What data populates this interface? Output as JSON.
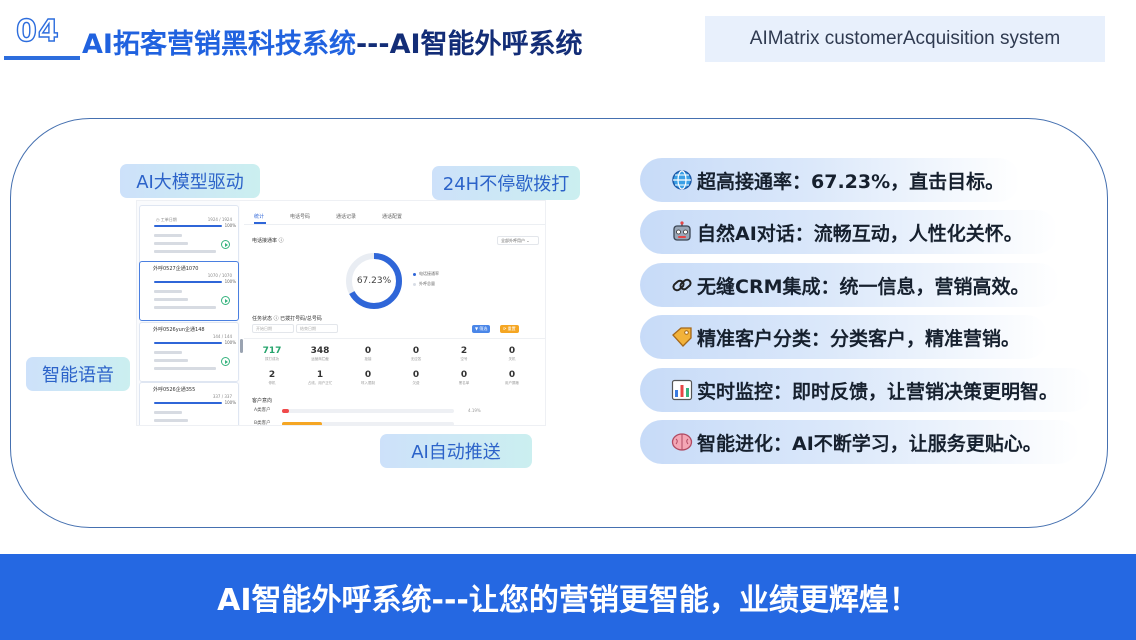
{
  "header": {
    "number": "04",
    "title_part1": "AI拓客营销黑科技系统",
    "title_part2": "---AI智能外呼系统",
    "subtitle": "AIMatrix customerAcquisition system"
  },
  "callouts": {
    "top_left": "AI大模型驱动",
    "top_right": "24H不停歇拨打",
    "left": "智能语音",
    "bottom": "AI自动推送"
  },
  "features": [
    {
      "icon": "globe-icon",
      "text": "超高接通率：67.23%，直击目标。"
    },
    {
      "icon": "robot-icon",
      "text": "自然AI对话：流畅互动，人性化关怀。"
    },
    {
      "icon": "link-icon",
      "text": "无缝CRM集成：统一信息，营销高效。"
    },
    {
      "icon": "tag-icon",
      "text": "精准客户分类：分类客户，精准营销。"
    },
    {
      "icon": "bar-chart-icon",
      "text": "实时监控：即时反馈，让营销决策更明智。"
    },
    {
      "icon": "brain-icon",
      "text": "智能进化：AI不断学习，让服务更贴心。"
    }
  ],
  "screenshot": {
    "tasks": [
      {
        "name": "",
        "count": "1924 / 1924",
        "pct": "100%",
        "active": false
      },
      {
        "name": "外呼0527企通1070",
        "count": "1070 / 1070",
        "pct": "100%",
        "active": true
      },
      {
        "name": "外呼0526yun企通148",
        "count": "144 / 144",
        "pct": "100%",
        "active": false
      },
      {
        "name": "外呼0526企通355",
        "count": "337 / 337",
        "pct": "100%",
        "active": false
      }
    ],
    "donut_label": "67.23%",
    "connect_rate": 0.6723,
    "stats_row1": [
      {
        "value": "717",
        "highlight": true
      },
      {
        "value": "348",
        "highlight": false
      },
      {
        "value": "0",
        "highlight": false
      },
      {
        "value": "0",
        "highlight": false
      },
      {
        "value": "2",
        "highlight": false
      },
      {
        "value": "0",
        "highlight": false
      }
    ],
    "stats_row2": [
      {
        "value": "2"
      },
      {
        "value": "1"
      },
      {
        "value": "0"
      },
      {
        "value": "0"
      },
      {
        "value": "0"
      },
      {
        "value": "0"
      }
    ],
    "dist_pct": "4.19%",
    "dist_share": 0.0419,
    "colors": {
      "primary": "#2f66d8",
      "green": "#25a46c",
      "red": "#f0494a",
      "orange": "#f5a623"
    }
  },
  "footer": {
    "text": "AI智能外呼系统---让您的营销更智能，业绩更辉煌！"
  }
}
